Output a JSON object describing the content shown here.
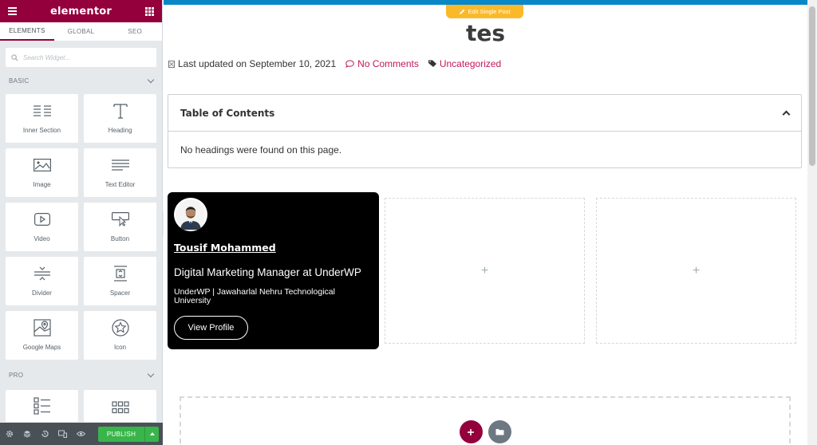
{
  "app": {
    "brand": "elementor"
  },
  "sidebar": {
    "tabs": [
      {
        "label": "ELEMENTS"
      },
      {
        "label": "GLOBAL"
      },
      {
        "label": "SEO"
      }
    ],
    "search_placeholder": "Search Widget...",
    "sections": {
      "basic": "BASIC",
      "pro": "PRO"
    },
    "widgets": [
      {
        "label": "Inner Section",
        "icon": "inner-section-icon"
      },
      {
        "label": "Heading",
        "icon": "heading-icon"
      },
      {
        "label": "Image",
        "icon": "image-icon"
      },
      {
        "label": "Text Editor",
        "icon": "text-editor-icon"
      },
      {
        "label": "Video",
        "icon": "video-icon"
      },
      {
        "label": "Button",
        "icon": "button-icon"
      },
      {
        "label": "Divider",
        "icon": "divider-icon"
      },
      {
        "label": "Spacer",
        "icon": "spacer-icon"
      },
      {
        "label": "Google Maps",
        "icon": "google-maps-icon"
      },
      {
        "label": "Icon",
        "icon": "star-icon"
      }
    ],
    "footer": {
      "publish_label": "PUBLISH"
    }
  },
  "canvas": {
    "edit_tag": "Edit Single Post",
    "post_title": "tes",
    "meta": {
      "updated": "Last updated on September 10, 2021",
      "comments": "No Comments",
      "category": "Uncategorized"
    },
    "toc": {
      "title": "Table of Contents",
      "empty_message": "No headings were found on this page."
    },
    "profile": {
      "name": "Tousif Mohammed",
      "role": "Digital Marketing Manager at UnderWP",
      "org": "UnderWP | Jawaharlal Nehru Technological University",
      "button": "View Profile"
    },
    "empty_column_plus": "+"
  },
  "colors": {
    "brand": "#93003c",
    "publish": "#39b54a",
    "link": "#c2185b",
    "topbar": "#0a87c7",
    "edit_tag": "#fbb929"
  }
}
